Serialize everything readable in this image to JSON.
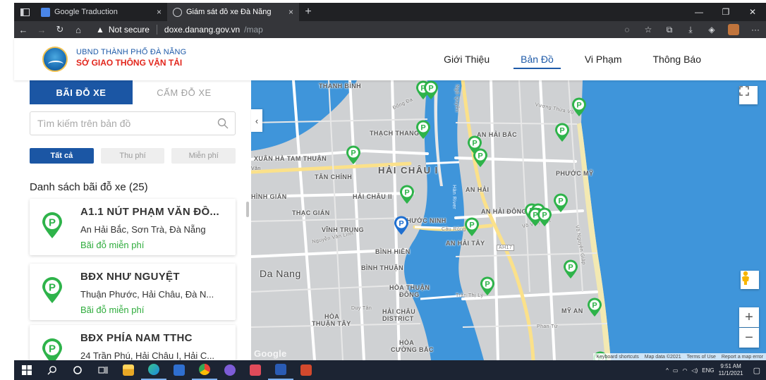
{
  "browser": {
    "tabs": [
      {
        "title": "Google Traduction",
        "close": "×",
        "fav_color": "#4a86e8"
      },
      {
        "title": "Giám sát đỗ xe Đà Nẵng",
        "close": "×",
        "fav_color": "#e8e8e8"
      }
    ],
    "new_tab": "+",
    "security_label": "Not secure",
    "url_host": "doxe.danang.gov.vn",
    "url_path": "/map"
  },
  "site": {
    "org_line1": "UBND THÀNH PHỐ ĐÀ NẴNG",
    "org_line2": "SỞ GIAO THÔNG VẬN TẢI",
    "menu": [
      "Giới Thiệu",
      "Bản Đồ",
      "Vi Phạm",
      "Thông Báo"
    ]
  },
  "panel": {
    "tab_parking": "BÃI ĐỖ XE",
    "tab_noparking": "CẤM ĐỖ XE",
    "search_placeholder": "Tìm kiếm trên bản đồ",
    "filters": [
      "Tất cả",
      "Thu phí",
      "Miễn phí"
    ],
    "list_title": "Danh sách bãi đỗ xe (25)",
    "items": [
      {
        "name": "A1.1 NÚT PHẠM VĂN ĐỒ...",
        "address": "An Hải Bắc, Sơn Trà, Đà Nẵng",
        "status": "Bãi đỗ miễn phí"
      },
      {
        "name": "BĐX NHƯ NGUYỆT",
        "address": "Thuận Phước, Hải Châu, Đà N...",
        "status": "Bãi đỗ miễn phí"
      },
      {
        "name": "BĐX PHÍA NAM TTHC",
        "address": "24 Trần Phú, Hải Châu I, Hải C...",
        "status": ""
      }
    ]
  },
  "map": {
    "labels": {
      "thanh_binh": "THANH BÌNH",
      "thach_thang": "THẠCH THANG",
      "an_hai_bac": "AN HẢI BẮC",
      "xuan_ha": "XUÂN HÀ TAM THUẬN",
      "tan_chinh": "TÂN CHÍNH",
      "hai_chau_i": "HẢI CHÂU I",
      "phuoc_my": "PHƯỚC MỸ",
      "an_hai": "AN HẢI",
      "hinh_gian": "HÌNH GIÁN",
      "hai_chau_ii": "HẢI CHÂU II",
      "thac_gian": "THẠC GIÁN",
      "phuoc_ninh": "PHƯỚC NINH",
      "an_hai_dong": "AN HẢI ĐÔNG",
      "vinh_trung": "VĨNH TRUNG",
      "an_hai_tay": "AN HẢI TÂY",
      "binh_hien": "BÌNH HIÊN",
      "binh_thuan": "BÌNH THUẬN",
      "da_nang": "Da Nang",
      "hoa_thuan_dong_1": "HÒA THUẬN",
      "hoa_thuan_dong_2": "ĐÔNG",
      "hai_chau_district_1": "HẢI CHÂU",
      "hai_chau_district_2": "DISTRICT",
      "hoa_thuan_tay_1": "HÒA",
      "hoa_thuan_tay_2": "THUẬN TÂY",
      "my_an": "MỸ AN",
      "hoa_cuong_bac_1": "HÒA",
      "hoa_cuong_bac_2": "CƯỜNG BẮC",
      "han_river": "Hàn River",
      "ah17": "AH17",
      "cau_rong": "Cầu Rồng",
      "dong_da": "Đống Đa",
      "vuong_thua_vu": "Vương Thừa Vũ",
      "vo_van_kiet": "Võ Văn Kiệt",
      "nguyen_van_linh": "Nguyễn Văn Linh",
      "tran_thi_ly": "Trần Thị Lý",
      "duy_tan": "Duy Tân",
      "phan_tu": "Phan Tứ",
      "ngo_quyen": "Ngô Quyền",
      "nguyen_giao": "Võ Nguyên Giáp",
      "van": "Vân"
    },
    "google": "Google",
    "attribution": [
      "Keyboard shortcuts",
      "Map data ©2021",
      "Terms of Use",
      "Report a map error"
    ],
    "zoom_in": "+",
    "zoom_out": "−",
    "pin_letter": "P",
    "pin_color": "#2eb34a",
    "pin_selected_color": "#1e6fd0"
  },
  "taskbar": {
    "time": "9:51 AM",
    "date": "11/1/2021",
    "lang": "ENG"
  }
}
